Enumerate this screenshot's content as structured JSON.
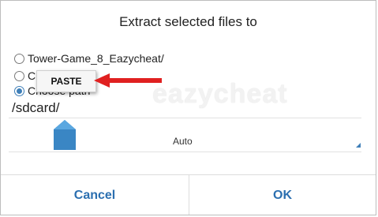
{
  "dialog": {
    "title": "Extract selected files to",
    "options": [
      {
        "label": "Tower-Game_8_Eazycheat/",
        "checked": false
      },
      {
        "label": "C",
        "checked": false
      },
      {
        "label": "Choose path",
        "checked": true
      }
    ],
    "path_value": "/sdcard/",
    "spinner_value": "Auto",
    "cancel_label": "Cancel",
    "ok_label": "OK"
  },
  "context_menu": {
    "paste_label": "PASTE"
  },
  "watermark": "eazycheat",
  "colors": {
    "accent": "#2b6fb0",
    "arrow": "#e02020",
    "handle": "#3a86c4"
  }
}
